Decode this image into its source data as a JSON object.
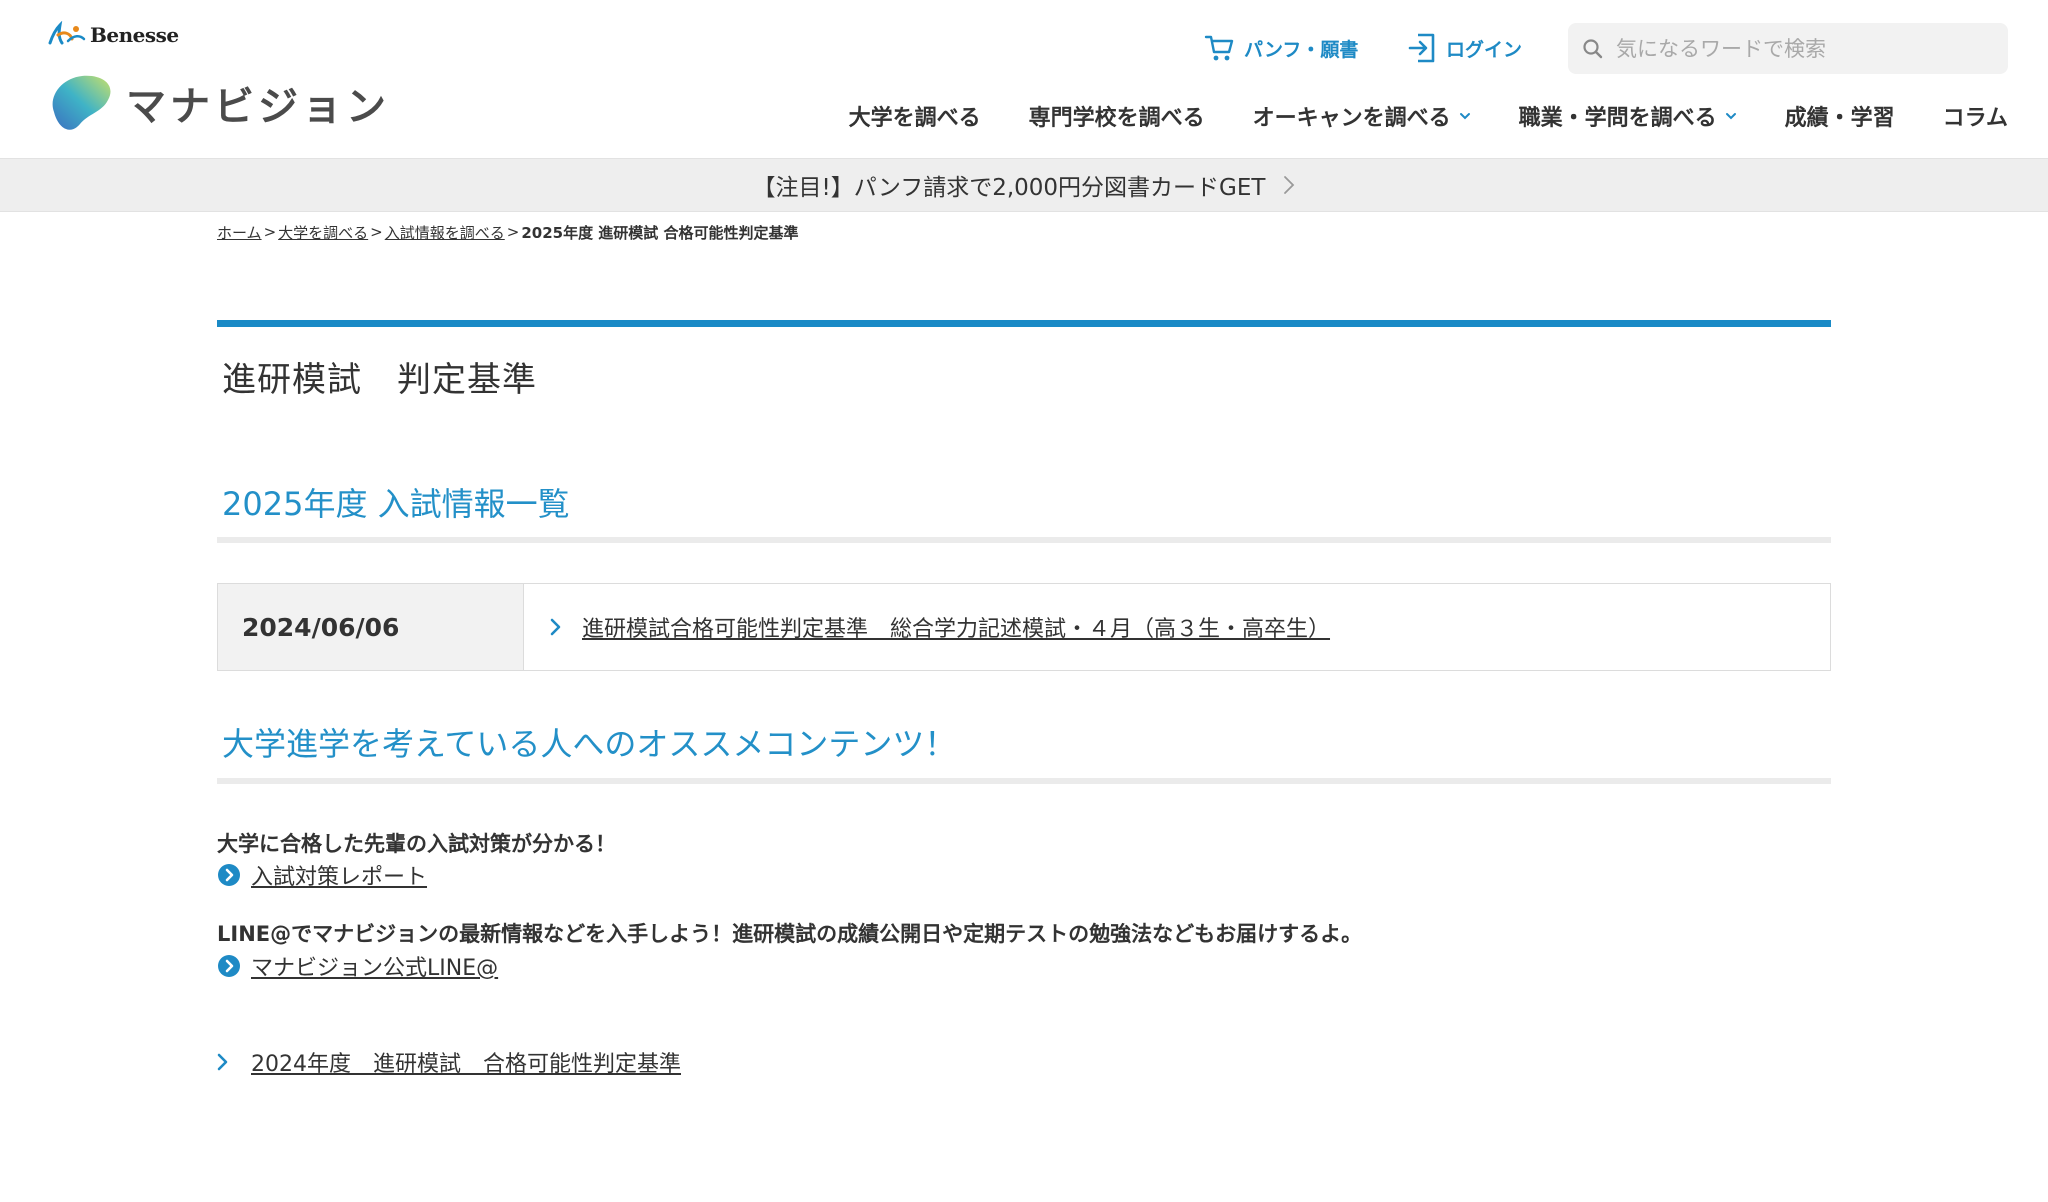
{
  "header": {
    "brand_corporate": "Benesse",
    "brand_site": "マナビジョン",
    "pamphlet_label": "パンフ・願書",
    "login_label": "ログイン",
    "search_placeholder": "気になるワードで検索",
    "nav": [
      {
        "label": "大学を調べる",
        "has_dropdown": false
      },
      {
        "label": "専門学校を調べる",
        "has_dropdown": false
      },
      {
        "label": "オーキャンを調べる",
        "has_dropdown": true
      },
      {
        "label": "職業・学問を調べる",
        "has_dropdown": true
      },
      {
        "label": "成績・学習",
        "has_dropdown": false
      },
      {
        "label": "コラム",
        "has_dropdown": false
      }
    ]
  },
  "promo": {
    "text": "【注目!】パンフ請求で2,000円分図書カードGET"
  },
  "breadcrumb": {
    "items": [
      "ホーム",
      "大学を調べる",
      "入試情報を調べる"
    ],
    "separator": ">",
    "current": "2025年度 進研模試 合格可能性判定基準"
  },
  "page": {
    "title": "進研模試　判定基準",
    "section1_heading": "2025年度 入試情報一覧",
    "entries": [
      {
        "date": "2024/06/06",
        "link": "進研模試合格可能性判定基準　総合学力記述模試・４月（高３生・高卒生）"
      }
    ],
    "section2_heading": "大学進学を考えている人へのオススメコンテンツ！",
    "recommendations": [
      {
        "lead": "大学に合格した先輩の入試対策が分かる！",
        "link": "入試対策レポート"
      },
      {
        "lead": "LINE@でマナビジョンの最新情報などを入手しよう！進研模試の成績公開日や定期テストの勉強法などもお届けするよ。",
        "link": "マナビジョン公式LINE@"
      }
    ],
    "previous_year_link": "2024年度　進研模試　合格可能性判定基準"
  },
  "colors": {
    "accent": "#1a8ac6",
    "text": "#333333",
    "promo_bg": "#eeeeee"
  }
}
